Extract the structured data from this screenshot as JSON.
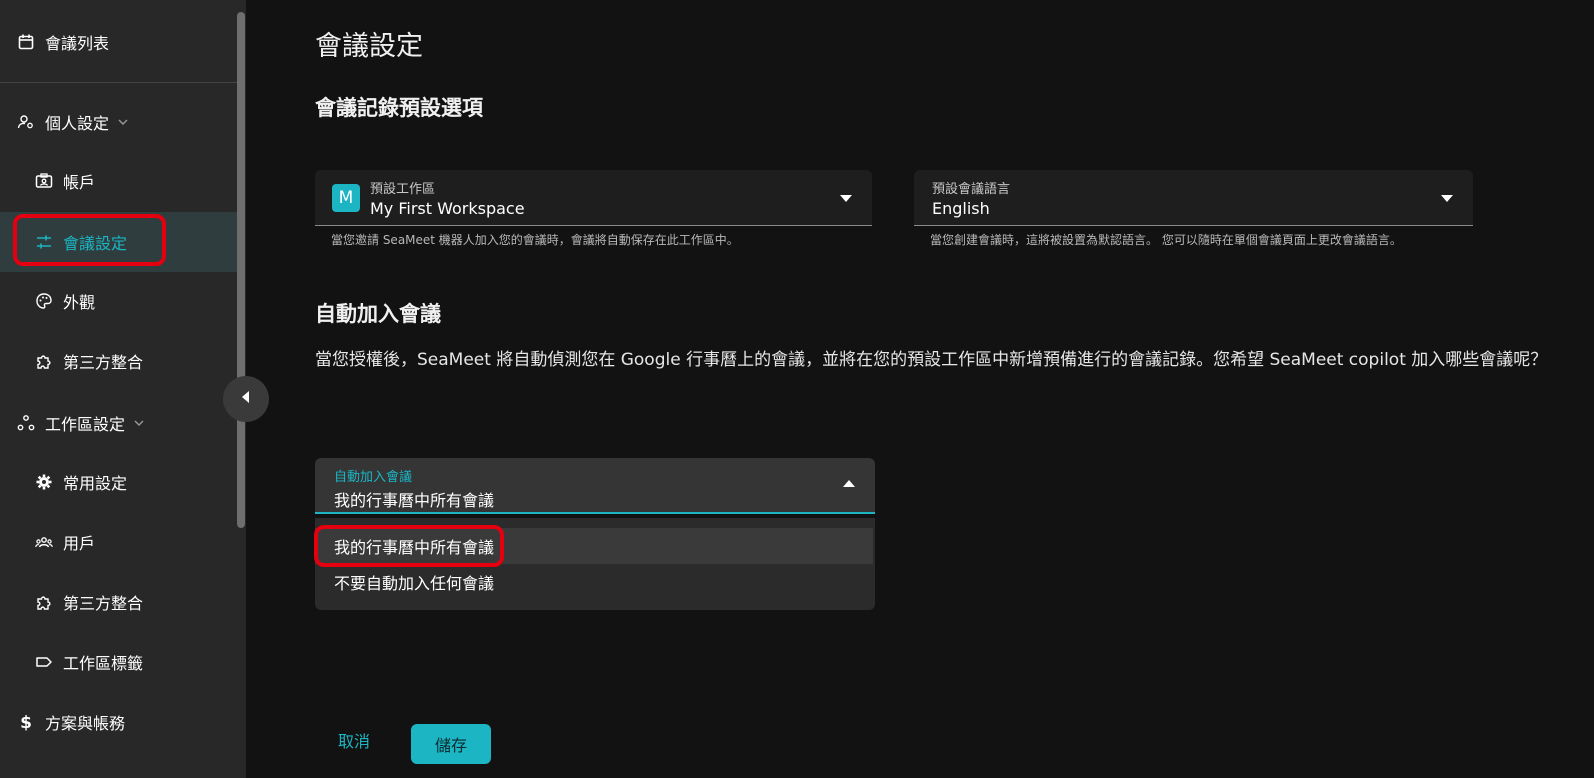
{
  "sidebar": {
    "meetings_list": "會議列表",
    "personal_settings": "個人設定",
    "account": "帳戶",
    "meeting_settings": "會議設定",
    "appearance": "外觀",
    "integrations_personal": "第三方整合",
    "workspace_settings": "工作區設定",
    "general_settings": "常用設定",
    "users": "用戶",
    "integrations_workspace": "第三方整合",
    "workspace_labels": "工作區標籤",
    "plans_billing": "方案與帳務"
  },
  "main": {
    "page_title": "會議設定",
    "section_defaults": "會議記錄預設選項",
    "workspace_select": {
      "label": "預設工作區",
      "badge": "M",
      "value": "My First Workspace",
      "helper": "當您邀請 SeaMeet 機器人加入您的會議時，會議將自動保存在此工作區中。"
    },
    "language_select": {
      "label": "預設會議語言",
      "value": "English",
      "helper": "當您創建會議時，這將被設置為默認語言。 您可以隨時在單個會議頁面上更改會議語言。"
    },
    "section_autojoin": "自動加入會議",
    "autojoin_desc": "當您授權後，SeaMeet 將自動偵測您在 Google 行事曆上的會議，並將在您的預設工作區中新增預備進行的會議記錄。您希望 SeaMeet copilot 加入哪些會議呢？",
    "autojoin_select": {
      "label": "自動加入會議",
      "value": "我的行事曆中所有會議",
      "options": [
        "我的行事曆中所有會議",
        "不要自動加入任何會議"
      ]
    },
    "cancel_label": "取消",
    "save_label": "儲存"
  },
  "colors": {
    "accent": "#1cb5c4",
    "highlight": "#e4000f",
    "sidebar_bg": "#282828",
    "main_bg": "#121212"
  }
}
